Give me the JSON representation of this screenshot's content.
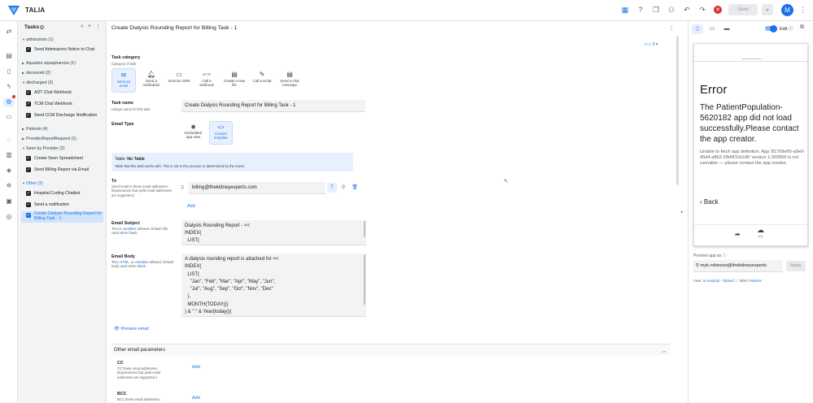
{
  "app": {
    "name": "TALIA",
    "avatar_letter": "M",
    "save_label": "Save"
  },
  "tasks_panel": {
    "title": "Tasks",
    "groups": [
      {
        "label": "admissions (1)",
        "items": [
          "Send Admissions Notice to Chat"
        ]
      },
      {
        "label": "Aquadex aquapharesis (1)",
        "items": []
      },
      {
        "label": "deceased (2)",
        "items": []
      },
      {
        "label": "discharged (3)",
        "items": [
          "ADT Chat Webhook",
          "TCM Chat Webhook",
          "Send CCM Discharge Notification"
        ]
      },
      {
        "label": "Patients (4)",
        "items": []
      },
      {
        "label": "ProviderReportRequest (1)",
        "items": []
      },
      {
        "label": "Seen by Provider (2)",
        "items": [
          "Create Seen Spreadsheet",
          "Send Billing Report via Email"
        ]
      },
      {
        "label": "Other (3)",
        "items": [
          "Hospital Coding Chatbot",
          "Send a notification",
          "Create Dialysis Rounding Report for Billing Task - 1"
        ]
      }
    ]
  },
  "editor": {
    "title": "Create Dialysis Rounding Report for Billing Task - 1",
    "link_count": "0",
    "task_category": {
      "label": "Task category",
      "hint": "Category of task",
      "options": [
        "Send an email",
        "Send a notification",
        "Send an SMS",
        "Call a webhook",
        "Create a new file",
        "Call a script",
        "Send a chat message"
      ]
    },
    "task_name": {
      "label": "Task name",
      "hint": "Unique name for this task",
      "value": "Create Dialysis Rounding Report for Billing Task - 1"
    },
    "email_type": {
      "label": "Email Type",
      "options": [
        "Embedded app view",
        "Custom template"
      ]
    },
    "table": {
      "prefix": "Table:",
      "value": "No Table",
      "hint": "Table that this task works with. This is set in the process or determined by the event."
    },
    "to": {
      "label": "To",
      "hint": "Send email to these email addresses. (Expressions that yield email addresses are supported.)",
      "value": "billing@thekidneyexperts.com",
      "add_label": "Add"
    },
    "subject": {
      "label": "Email Subject",
      "hint_a": "Text or",
      "hint_link": "variables",
      "hint_b": "allowed. Default title used when blank.",
      "lines": [
        "Dialysis Rounding Report - <<",
        "INDEX(",
        "  LIST("
      ]
    },
    "body": {
      "label": "Email Body",
      "hint_a": "Text,",
      "hint_link1": "HTML",
      "hint_mid": ", or",
      "hint_link2": "variables",
      "hint_b": "allowed. Default body used when blank.",
      "lines": [
        "A dialysis rounding report is attached for <<",
        "INDEX(",
        "  LIST(",
        "    \"Jan\", \"Feb\", \"Mar\", \"Apr\", \"May\", \"Jun\",",
        "    \"Jul\", \"Aug\", \"Sep\", \"Oct\", \"Nov\", \"Dec\"",
        "  ),",
        "  MONTH(TODAY())",
        ") & \" \" & Year(today())"
      ]
    },
    "preview_label": "Preview email",
    "other_params": {
      "label": "Other email parameters"
    },
    "cc": {
      "label": "CC",
      "hint": "CC these email addresses. (Expressions that yield email addresses are supported.)",
      "add_label": "Add"
    },
    "bcc": {
      "label": "BCC",
      "hint": "BCC these email addresses.",
      "add_label": "Add"
    }
  },
  "preview_panel": {
    "edit_label": "Edit",
    "error_title": "Error",
    "error_message": "The PatientPopulation-5620182 app did not load successfully.Please contact the app creator.",
    "error_detail": "Unable to fetch app definition. App '81769e65-a9e0-45d4-a862-28d0f11b1d6' version 1.003069 is not runnable — please contact the app creator.",
    "back_label": "Back",
    "preview_as_label": "Preview app as",
    "preview_as_value": "myk.robinson@thekidneyexperts",
    "apply_label": "Apply",
    "view_prefix": "View:",
    "view_value": "In Hospital - Tabbed",
    "table_prefix": "Table:",
    "table_value": "Patients"
  }
}
